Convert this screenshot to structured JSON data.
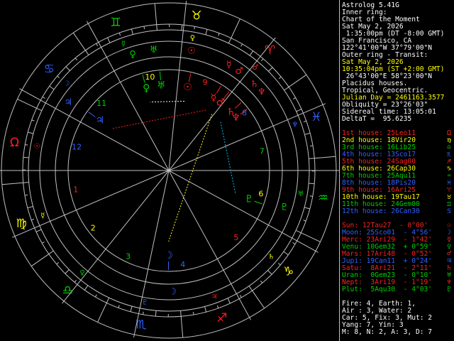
{
  "info": [
    {
      "text": "Astrolog 5.41G",
      "color": "#ffffff"
    },
    {
      "text": "Inner ring:",
      "color": "#ffffff"
    },
    {
      "text": "Chart of the Moment",
      "color": "#ffffff"
    },
    {
      "text": "Sat May 2, 2026",
      "color": "#ffffff"
    },
    {
      "text": " 1:35:00pm (DT -8:00 GMT)",
      "color": "#ffffff"
    },
    {
      "text": "San Francisco, CA",
      "color": "#ffffff"
    },
    {
      "text": "122°41'00\"W 37°79'00\"N",
      "color": "#ffffff"
    },
    {
      "text": "Outer ring - Transit:",
      "color": "#ffffff"
    },
    {
      "text": "Sat May 2, 2026",
      "color": "#ffff00"
    },
    {
      "text": "10:35:04pm (ST +2:00 GMT)",
      "color": "#ffff00"
    },
    {
      "text": " 26°43'00\"E 58°23'00\"N",
      "color": "#ffffff"
    },
    {
      "text": "Placidus houses.",
      "color": "#ffffff"
    },
    {
      "text": "Tropical, Geocentric.",
      "color": "#ffffff"
    },
    {
      "text": "Julian Day = 2461163.3577",
      "color": "#ffff00"
    },
    {
      "text": "Obliquity = 23°26'03\"",
      "color": "#ffffff"
    },
    {
      "text": "Sidereal time: 13:05:01",
      "color": "#ffffff"
    },
    {
      "text": "DeltaT =  95.6235",
      "color": "#ffffff"
    }
  ],
  "houses": [
    {
      "text": "1st house: 25Leo11",
      "sign": "Ω",
      "color": "#ff2020"
    },
    {
      "text": "2nd house: 18Vir20",
      "sign": "♍",
      "color": "#ffff00"
    },
    {
      "text": "3rd house: 16Lib25",
      "sign": "♎",
      "color": "#00d000"
    },
    {
      "text": "4th house: 13Sco17",
      "sign": "♏",
      "color": "#3060ff"
    },
    {
      "text": "5th house: 24Sag00",
      "sign": "♐",
      "color": "#ff2020"
    },
    {
      "text": "6th house: 26Cap30",
      "sign": "♑",
      "color": "#ffff00"
    },
    {
      "text": "7th house: 25Aqu11",
      "sign": "♒",
      "color": "#00d000"
    },
    {
      "text": "8th house: 18Pis20",
      "sign": "♓",
      "color": "#3060ff"
    },
    {
      "text": "9th house: 16Ari25",
      "sign": "♈",
      "color": "#ff2020"
    },
    {
      "text": "10th house: 19Tau17",
      "sign": "♉",
      "color": "#ffff00"
    },
    {
      "text": "11th house: 24Gem00",
      "sign": "♊",
      "color": "#00d000"
    },
    {
      "text": "12th house: 26Can30",
      "sign": "♋",
      "color": "#3060ff"
    }
  ],
  "planets": [
    {
      "text": "Sun: 12Tau27  - 0°00'",
      "glyph": "☉",
      "color": "#ff2020"
    },
    {
      "text": "Moon: 25Sco01  - 4°56'",
      "glyph": "☽",
      "color": "#3060ff"
    },
    {
      "text": "Merc: 23Ari29  - 1°42'",
      "glyph": "☿",
      "color": "#ff2020"
    },
    {
      "text": "Venu: 10Gem32  + 0°59'",
      "glyph": "♀",
      "color": "#00d000"
    },
    {
      "text": "Mars: 17Ari48  - 0°52'",
      "glyph": "♂",
      "color": "#ff2020"
    },
    {
      "text": "Jupi: 19Can11  + 0°24'",
      "glyph": "♃",
      "color": "#3060ff"
    },
    {
      "text": "Satu:  8Ari21  - 2°11'",
      "glyph": "♄",
      "color": "#ff2020"
    },
    {
      "text": "Uran:  0Gem23  - 0°10'",
      "glyph": "♅",
      "color": "#00d000"
    },
    {
      "text": "Nept:  3Ari19  - 1°19'",
      "glyph": "♆",
      "color": "#ff2020"
    },
    {
      "text": "Plut:  5Aqu30  - 4°03'",
      "glyph": "♇",
      "color": "#00d000"
    }
  ],
  "summary": [
    {
      "text": "Fire: 4, Earth: 1,",
      "color": "#ffffff"
    },
    {
      "text": "Air : 3, Water: 2",
      "color": "#ffffff"
    },
    {
      "text": "Car: 5, Fix: 3, Mut: 2",
      "color": "#ffffff"
    },
    {
      "text": "Yang: 7, Yin: 3",
      "color": "#ffffff"
    },
    {
      "text": "M: 8, N: 2, A: 3, D: 7",
      "color": "#ffffff"
    }
  ],
  "wheel": {
    "house_numbers": [
      "1",
      "2",
      "3",
      "4",
      "5",
      "6",
      "7",
      "8",
      "9",
      "10",
      "11",
      "12"
    ],
    "signs": [
      {
        "glyph": "♈",
        "color": "#ff2020"
      },
      {
        "glyph": "♉",
        "color": "#ffff00"
      },
      {
        "glyph": "♊",
        "color": "#00d000"
      },
      {
        "glyph": "♋",
        "color": "#3060ff"
      },
      {
        "glyph": "Ω",
        "color": "#ff2020"
      },
      {
        "glyph": "♍",
        "color": "#ffff00"
      },
      {
        "glyph": "♎",
        "color": "#00d000"
      },
      {
        "glyph": "♏",
        "color": "#3060ff"
      },
      {
        "glyph": "♐",
        "color": "#ff2020"
      },
      {
        "glyph": "♑",
        "color": "#ffff00"
      },
      {
        "glyph": "♒",
        "color": "#00d000"
      },
      {
        "glyph": "♓",
        "color": "#3060ff"
      }
    ],
    "ruler_glyphs": [
      {
        "glyph": "♂",
        "color": "#ff2020"
      },
      {
        "glyph": "♀",
        "color": "#ffff00"
      },
      {
        "glyph": "☿",
        "color": "#00d000"
      },
      {
        "glyph": "☽",
        "color": "#3060ff"
      },
      {
        "glyph": "☉",
        "color": "#ff2020"
      },
      {
        "glyph": "☿",
        "color": "#ffff00"
      },
      {
        "glyph": "♀",
        "color": "#00d000"
      },
      {
        "glyph": "♇",
        "color": "#3060ff"
      },
      {
        "glyph": "♃",
        "color": "#ff2020"
      },
      {
        "glyph": "♄",
        "color": "#ffff00"
      },
      {
        "glyph": "♅",
        "color": "#00d000"
      },
      {
        "glyph": "♆",
        "color": "#3060ff"
      }
    ]
  }
}
